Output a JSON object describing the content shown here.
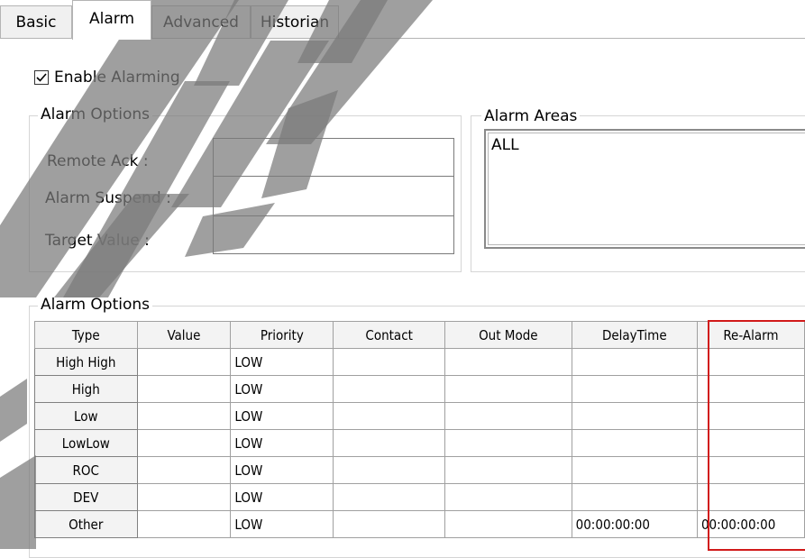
{
  "tabs": [
    {
      "label": "Basic"
    },
    {
      "label": "Alarm"
    },
    {
      "label": "Advanced"
    },
    {
      "label": "Historian"
    }
  ],
  "enable_alarming": {
    "label": "Enable Alarming",
    "checked": true
  },
  "alarm_options_top": {
    "title": "Alarm Options",
    "remote_ack_label": "Remote Ack :",
    "alarm_suspend_label": "Alarm Suspend :",
    "target_value_label": "Target Value :",
    "remote_ack_value": "",
    "alarm_suspend_value": "",
    "target_value_value": ""
  },
  "alarm_areas": {
    "title": "Alarm Areas",
    "items": [
      "ALL"
    ]
  },
  "alarm_options_grid": {
    "title": "Alarm Options",
    "columns": [
      "Type",
      "Value",
      "Priority",
      "Contact",
      "Out Mode",
      "DelayTime",
      "Re-Alarm"
    ],
    "rows": [
      [
        "High High",
        "",
        "LOW",
        "",
        "",
        "",
        ""
      ],
      [
        "High",
        "",
        "LOW",
        "",
        "",
        "",
        ""
      ],
      [
        "Low",
        "",
        "LOW",
        "",
        "",
        "",
        ""
      ],
      [
        "LowLow",
        "",
        "LOW",
        "",
        "",
        "",
        ""
      ],
      [
        "ROC",
        "",
        "LOW",
        "",
        "",
        "",
        ""
      ],
      [
        "DEV",
        "",
        "LOW",
        "",
        "",
        "",
        ""
      ],
      [
        "Other",
        "",
        "LOW",
        "",
        "",
        "00:00:00:00",
        "00:00:00:00"
      ]
    ]
  },
  "colors": {
    "highlight_border": "#d11a1a",
    "watermark": "#7a7a7a"
  }
}
